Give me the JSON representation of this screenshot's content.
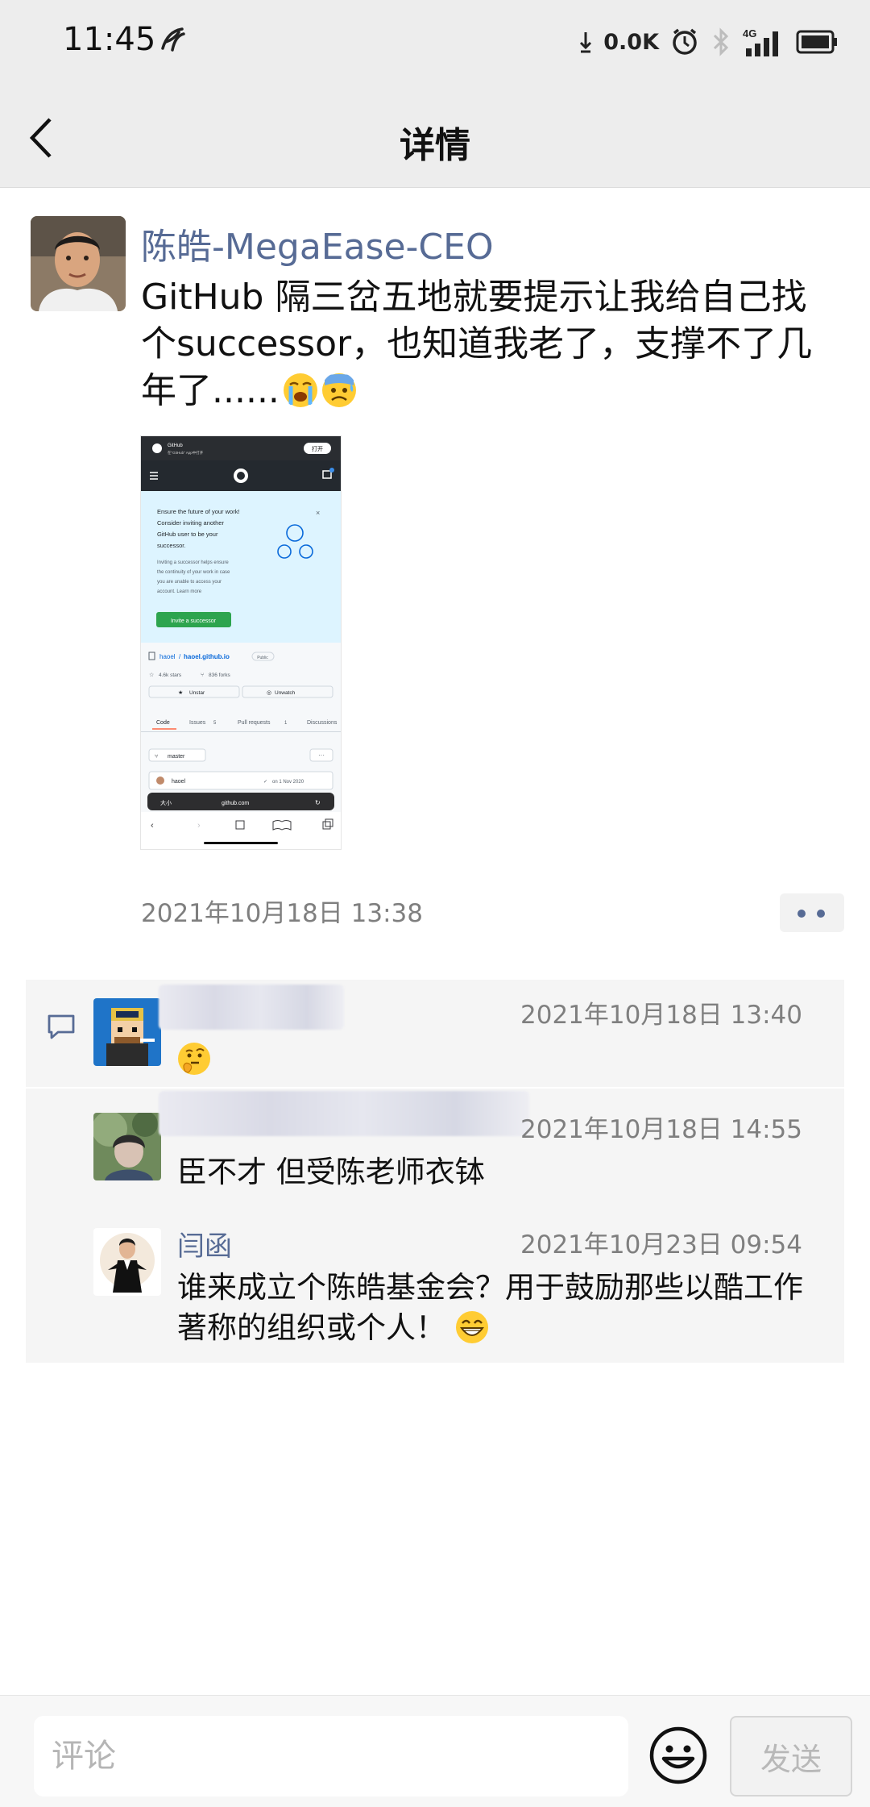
{
  "status_bar": {
    "time": "11:45",
    "net_speed": "0.0K",
    "network_type": "4G",
    "icons": [
      "carrier-icon",
      "download-arrow-icon",
      "alarm-icon",
      "bluetooth-icon",
      "signal-icon",
      "battery-icon"
    ]
  },
  "header": {
    "title": "详情",
    "back_icon": "chevron-left-icon"
  },
  "post": {
    "author": "陈皓-MegaEase-CEO",
    "text": "GitHub 隔三岔五地就要提示让我给自己找个successor，也知道我老了，支撑不了几年了......",
    "emojis": [
      "loudly-crying-face",
      "anxious-face-with-sweat"
    ],
    "time": "2021年10月18日 13:38",
    "more_icon": "more-dots-icon",
    "screenshot": {
      "app_name": "GitHub",
      "app_sub": "在\"GitHub\" App中打开",
      "open_label": "打开",
      "banner_title": "Ensure the future of your work! Consider inviting another GitHub user to be your successor.",
      "banner_body": "Inviting a successor helps ensure the continuity of your work in case you are unable to access your account. Learn more",
      "invite_button": "Invite a successor",
      "repo_owner": "haoel",
      "repo_name": "haoel.github.io",
      "repo_visibility": "Public",
      "stars": "4.6k stars",
      "forks": "836 forks",
      "unstar": "Unstar",
      "unwatch": "Unwatch",
      "tabs": [
        "Code",
        "Issues",
        "Pull requests",
        "Discussions"
      ],
      "issues_count": "5",
      "pr_count": "1",
      "branch": "master",
      "commit_user": "haoel",
      "commit_date": "on 1 Nov 2020",
      "url_text_size": "大小",
      "url": "github.com"
    }
  },
  "comments": [
    {
      "name": "",
      "time": "2021年10月18日 13:40",
      "text": "",
      "emoji": "thinking-face"
    },
    {
      "name": "",
      "time": "2021年10月18日 14:55",
      "text": "臣不才 但受陈老师衣钵"
    },
    {
      "name": "闫函",
      "time": "2021年10月23日 09:54",
      "text": "谁来成立个陈皓基金会？用于鼓励那些以酷工作著称的组织或个人！",
      "emoji": "grinning-face"
    }
  ],
  "comment_bar": {
    "placeholder": "评论",
    "send_label": "发送",
    "emoji_icon": "smiley-icon"
  },
  "colors": {
    "link_blue": "#576b95",
    "bar_gray": "#ededed",
    "comment_bg": "#f5f5f5",
    "github_green": "#2da44e"
  }
}
